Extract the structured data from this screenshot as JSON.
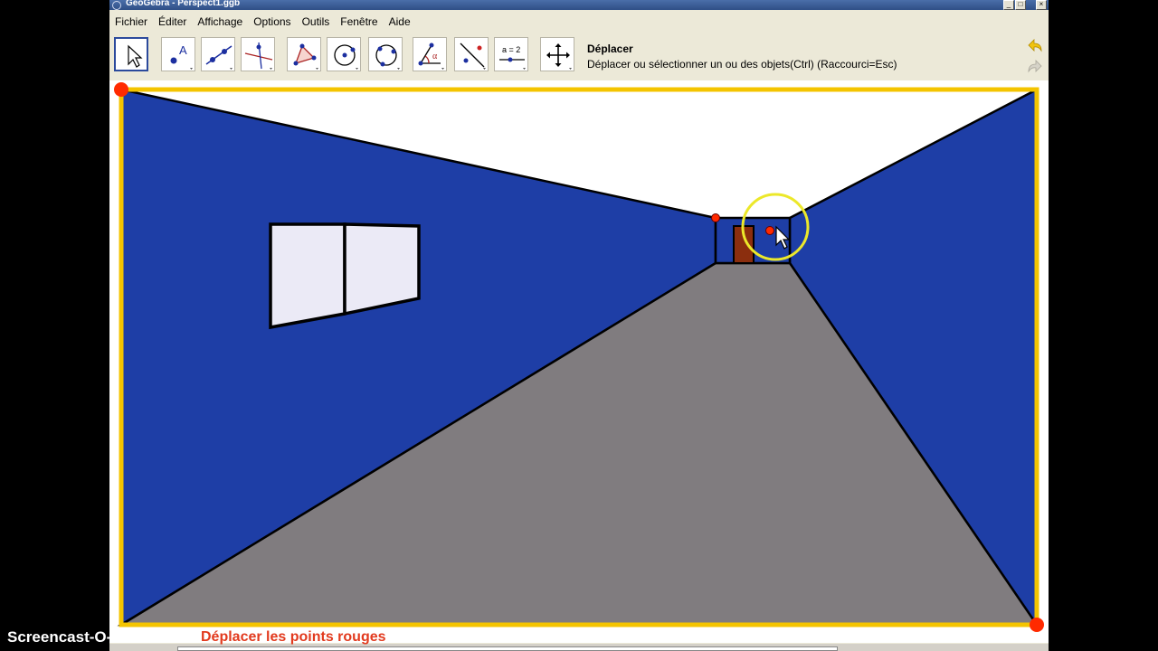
{
  "window": {
    "title": "GeoGebra - Perspect1.ggb",
    "controls": {
      "minimize": "_",
      "maximize": "□",
      "close": "×"
    }
  },
  "menubar": {
    "items": [
      "Fichier",
      "Éditer",
      "Affichage",
      "Options",
      "Outils",
      "Fenêtre",
      "Aide"
    ]
  },
  "toolbar": {
    "active_tool": {
      "title": "Déplacer",
      "description": "Déplacer ou sélectionner un ou des objets(Ctrl) (Raccourci=Esc)"
    },
    "tools": [
      {
        "name": "move-tool",
        "icon": "arrow-cursor-icon"
      },
      {
        "name": "point-tool",
        "icon": "point-a-icon",
        "label": "A"
      },
      {
        "name": "line-tool",
        "icon": "line-through-points-icon"
      },
      {
        "name": "perpendicular-tool",
        "icon": "perpendicular-line-icon"
      },
      {
        "name": "polygon-tool",
        "icon": "polygon-icon"
      },
      {
        "name": "circle-tool",
        "icon": "circle-center-icon"
      },
      {
        "name": "conic-tool",
        "icon": "circle-three-points-icon"
      },
      {
        "name": "angle-tool",
        "icon": "angle-alpha-icon",
        "label": "α"
      },
      {
        "name": "reflect-tool",
        "icon": "reflect-line-icon"
      },
      {
        "name": "slider-tool",
        "icon": "slider-icon",
        "label": "a = 2"
      },
      {
        "name": "translate-view-tool",
        "icon": "move-view-icon"
      }
    ],
    "undo_icon": "undo-icon",
    "redo_icon": "redo-icon"
  },
  "graphics": {
    "scene": "corridor-perspective",
    "colors": {
      "frame": "#f4c400",
      "walls": "#1e3ea6",
      "floor": "#807c7f",
      "ceiling": "#ffffff",
      "window_glass": "#ebeaf6",
      "door": "#8b2e0e",
      "points": "#ff2a00",
      "highlight": "#ece82a"
    }
  },
  "status": {
    "hint": "Déplacer les points rouges"
  },
  "overlay": {
    "watermark": "Screencast-O-Matic.com"
  }
}
